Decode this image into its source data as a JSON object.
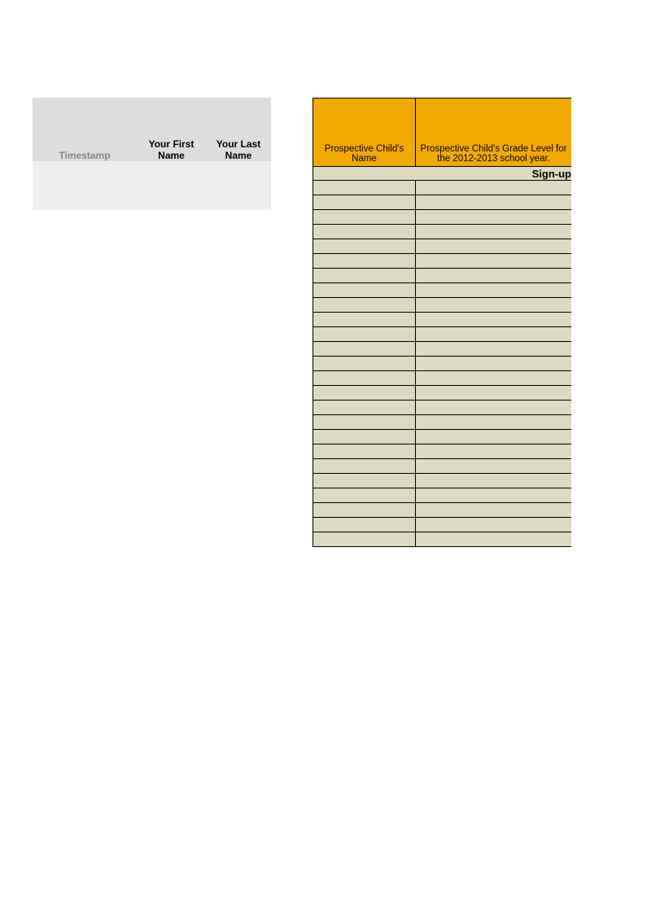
{
  "left": {
    "headers": {
      "timestamp": "Timestamp",
      "first_name": "Your First Name",
      "last_name": "Your Last Name"
    }
  },
  "right": {
    "headers": {
      "child_name": "Prospective Child's Name",
      "grade_level": "Prospective Child's Grade Level for the 2012-2013 school year."
    },
    "signup_label": "Sign-up",
    "row_count": 25
  }
}
